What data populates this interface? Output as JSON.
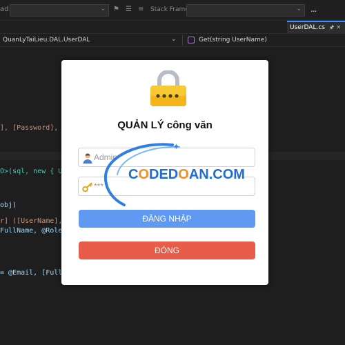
{
  "toolbar": {
    "left_label": "ad:",
    "stack_frame_label": "Stack Frame:",
    "more_label": "..."
  },
  "tabs": {
    "active_label": "UserDAL.cs"
  },
  "navbar": {
    "class_selector": "QuanLyTaiLieu.DAL.UserDAL",
    "method_selector": "Get(string UserName)"
  },
  "code": {
    "line1": "], [Password], [",
    "line2": "O>(sql, new { Us",
    "line3": "obj)",
    "line4": "r] ([UserName],",
    "line5": "FullName, @Role)",
    "line6": "= @Email, [FullN"
  },
  "login_dialog": {
    "title": "QUẢN LÝ công văn",
    "username_value": "Admin",
    "password_value": "***",
    "login_button": "ĐĂNG NHẬP",
    "close_button": "ĐÓNG"
  },
  "watermark": {
    "text_prefix": "C",
    "text_o": "O",
    "text_mid": "DED",
    "text_o2": "O",
    "text_suffix": "AN.COM"
  },
  "icons": {
    "lock": "lock-icon",
    "user": "user-icon",
    "key": "key-icon"
  }
}
